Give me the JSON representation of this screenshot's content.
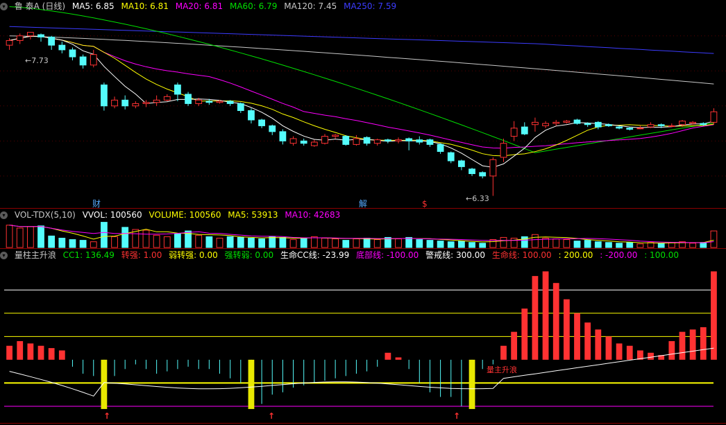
{
  "main_header": {
    "stock_title": "鲁 泰A (日线)",
    "ma5": "MA5: 6.85",
    "ma10": "MA10: 6.81",
    "ma20": "MA20: 6.81",
    "ma60": "MA60: 6.79",
    "ma120": "MA120: 7.45",
    "ma250": "MA250: 7.59"
  },
  "vol_header": {
    "name": "VOL-TDX(5,10)",
    "vvol": "VVOL: 100560",
    "volume": "VOLUME: 100560",
    "ma5": "MA5: 53913",
    "ma10": "MA10: 42683"
  },
  "ind_header": {
    "name": "量柱主升浪",
    "cc1": "CC1: 136.49",
    "zq": "转强: 1.00",
    "rzq": "弱转强: 0.00",
    "qzr": "强转弱: 0.00",
    "smcc": "生命CC线: -23.99",
    "dbx": "底部线: -100.00",
    "jjx": "警戒线: 300.00",
    "smx": "生命线: 100.00",
    "c200": ": 200.00",
    "cm200": ": -200.00",
    "c100": ": 100.00"
  },
  "annotations": {
    "high_price": "←7.73",
    "low_price": "←6.33",
    "event_cai": "财",
    "event_jie": "解",
    "event_s": "$",
    "signal_label": "量主升浪",
    "arrow": "↑"
  },
  "colors": {
    "up": "#ff3232",
    "down": "#54fcfc",
    "ma5": "#ffffff",
    "ma10": "#ffff00",
    "ma20": "#ff00ff",
    "ma60": "#00e000",
    "ma120": "#c8c8c8",
    "ma250": "#3c3cff",
    "label_gray": "#c8c8c8",
    "label_yellow": "#ffff00",
    "label_red": "#ff3232",
    "label_green": "#00e000",
    "label_magenta": "#ff00ff",
    "label_blue": "#3c3cff"
  },
  "chart_data": {
    "type": "candlestick",
    "candles": [
      [
        7.62,
        7.66,
        7.58,
        7.68
      ],
      [
        7.66,
        7.7,
        7.63,
        7.72
      ],
      [
        7.7,
        7.73,
        7.67,
        7.73
      ],
      [
        7.71,
        7.69,
        7.65,
        7.72
      ],
      [
        7.69,
        7.62,
        7.58,
        7.7
      ],
      [
        7.62,
        7.58,
        7.55,
        7.65
      ],
      [
        7.58,
        7.52,
        7.49,
        7.6
      ],
      [
        7.52,
        7.45,
        7.42,
        7.54
      ],
      [
        7.45,
        7.54,
        7.43,
        7.58
      ],
      [
        7.28,
        7.1,
        7.06,
        7.3
      ],
      [
        7.1,
        7.15,
        7.08,
        7.18
      ],
      [
        7.15,
        7.1,
        7.07,
        7.19
      ],
      [
        7.1,
        7.12,
        7.08,
        7.14
      ],
      [
        7.12,
        7.13,
        7.09,
        7.15
      ],
      [
        7.13,
        7.15,
        7.1,
        7.19
      ],
      [
        7.15,
        7.18,
        7.14,
        7.2
      ],
      [
        7.28,
        7.2,
        7.14,
        7.3
      ],
      [
        7.2,
        7.12,
        7.1,
        7.22
      ],
      [
        7.12,
        7.15,
        7.1,
        7.17
      ],
      [
        7.14,
        7.13,
        7.11,
        7.16
      ],
      [
        7.13,
        7.14,
        7.12,
        7.15
      ],
      [
        7.14,
        7.12,
        7.1,
        7.15
      ],
      [
        7.12,
        7.06,
        7.04,
        7.13
      ],
      [
        7.06,
        6.98,
        6.95,
        7.08
      ],
      [
        6.98,
        6.93,
        6.91,
        6.99
      ],
      [
        6.93,
        6.88,
        6.85,
        6.94
      ],
      [
        6.88,
        6.8,
        6.77,
        6.9
      ],
      [
        6.78,
        6.82,
        6.76,
        6.84
      ],
      [
        6.8,
        6.78,
        6.76,
        6.82
      ],
      [
        6.76,
        6.79,
        6.75,
        6.81
      ],
      [
        6.78,
        6.84,
        6.77,
        6.86
      ],
      [
        6.84,
        6.85,
        6.82,
        6.86
      ],
      [
        6.84,
        6.77,
        6.76,
        6.85
      ],
      [
        6.77,
        6.82,
        6.76,
        6.85
      ],
      [
        6.83,
        6.78,
        6.76,
        6.84
      ],
      [
        6.78,
        6.81,
        6.76,
        6.82
      ],
      [
        6.81,
        6.8,
        6.78,
        6.82
      ],
      [
        6.8,
        6.81,
        6.78,
        6.83
      ],
      [
        6.82,
        6.8,
        6.72,
        6.83
      ],
      [
        6.81,
        6.79,
        6.77,
        6.84
      ],
      [
        6.81,
        6.77,
        6.75,
        6.82
      ],
      [
        6.77,
        6.71,
        6.69,
        6.78
      ],
      [
        6.7,
        6.63,
        6.61,
        6.71
      ],
      [
        6.63,
        6.58,
        6.55,
        6.64
      ],
      [
        6.56,
        6.52,
        6.5,
        6.57
      ],
      [
        6.53,
        6.5,
        6.48,
        6.54
      ],
      [
        6.5,
        6.64,
        6.33,
        6.66
      ],
      [
        6.66,
        6.78,
        6.62,
        6.82
      ],
      [
        6.84,
        6.91,
        6.8,
        6.97
      ],
      [
        6.92,
        6.86,
        6.85,
        6.96
      ],
      [
        6.94,
        6.96,
        6.88,
        7.0
      ],
      [
        6.93,
        6.95,
        6.91,
        6.97
      ],
      [
        6.95,
        6.96,
        6.93,
        6.98
      ],
      [
        6.96,
        6.97,
        6.95,
        6.98
      ],
      [
        6.98,
        6.95,
        6.94,
        6.99
      ],
      [
        6.95,
        6.94,
        6.92,
        6.96
      ],
      [
        6.96,
        6.92,
        6.9,
        6.97
      ],
      [
        6.94,
        6.93,
        6.92,
        6.95
      ],
      [
        6.92,
        6.91,
        6.9,
        6.93
      ],
      [
        6.91,
        6.9,
        6.89,
        6.92
      ],
      [
        6.91,
        6.91,
        6.9,
        6.93
      ],
      [
        6.92,
        6.94,
        6.91,
        6.96
      ],
      [
        6.94,
        6.93,
        6.91,
        6.95
      ],
      [
        6.93,
        6.93,
        6.92,
        6.95
      ],
      [
        6.94,
        6.97,
        6.92,
        6.98
      ],
      [
        6.95,
        6.96,
        6.94,
        6.97
      ],
      [
        6.95,
        6.94,
        6.93,
        6.96
      ],
      [
        6.96,
        7.05,
        6.94,
        7.08
      ]
    ],
    "volume": [
      62,
      54,
      58,
      60,
      32,
      26,
      22,
      20,
      16,
      70,
      30,
      56,
      50,
      48,
      34,
      30,
      38,
      46,
      34,
      30,
      26,
      30,
      28,
      26,
      24,
      30,
      28,
      22,
      26,
      30,
      26,
      24,
      20,
      24,
      26,
      22,
      28,
      24,
      28,
      22,
      20,
      18,
      16,
      18,
      14,
      12,
      22,
      28,
      26,
      30,
      36,
      26,
      24,
      22,
      18,
      20,
      16,
      14,
      12,
      14,
      10,
      14,
      12,
      14,
      16,
      12,
      14,
      46
    ],
    "cc_values": [
      60,
      80,
      70,
      60,
      50,
      40,
      -30,
      -60,
      -70,
      -190,
      -70,
      -40,
      -20,
      -40,
      -60,
      -50,
      -40,
      -30,
      -40,
      -40,
      -60,
      -80,
      -100,
      -200,
      -190,
      -150,
      -140,
      -120,
      -110,
      -100,
      -90,
      -80,
      -70,
      -60,
      -50,
      -30,
      30,
      10,
      -40,
      -100,
      -140,
      -160,
      -160,
      -200,
      -80,
      -40,
      -20,
      60,
      120,
      220,
      360,
      380,
      330,
      260,
      200,
      160,
      130,
      100,
      70,
      60,
      40,
      30,
      20,
      80,
      120,
      130,
      140,
      380
    ],
    "y_ranges": {
      "price": [
        6.25,
        7.9
      ],
      "volume": [
        0,
        75
      ],
      "indicator": [
        -230,
        420
      ]
    },
    "red_arrow_indices": [
      9,
      23,
      44
    ],
    "yellow_bar_indices": [
      9,
      23,
      44
    ],
    "grid": true
  }
}
